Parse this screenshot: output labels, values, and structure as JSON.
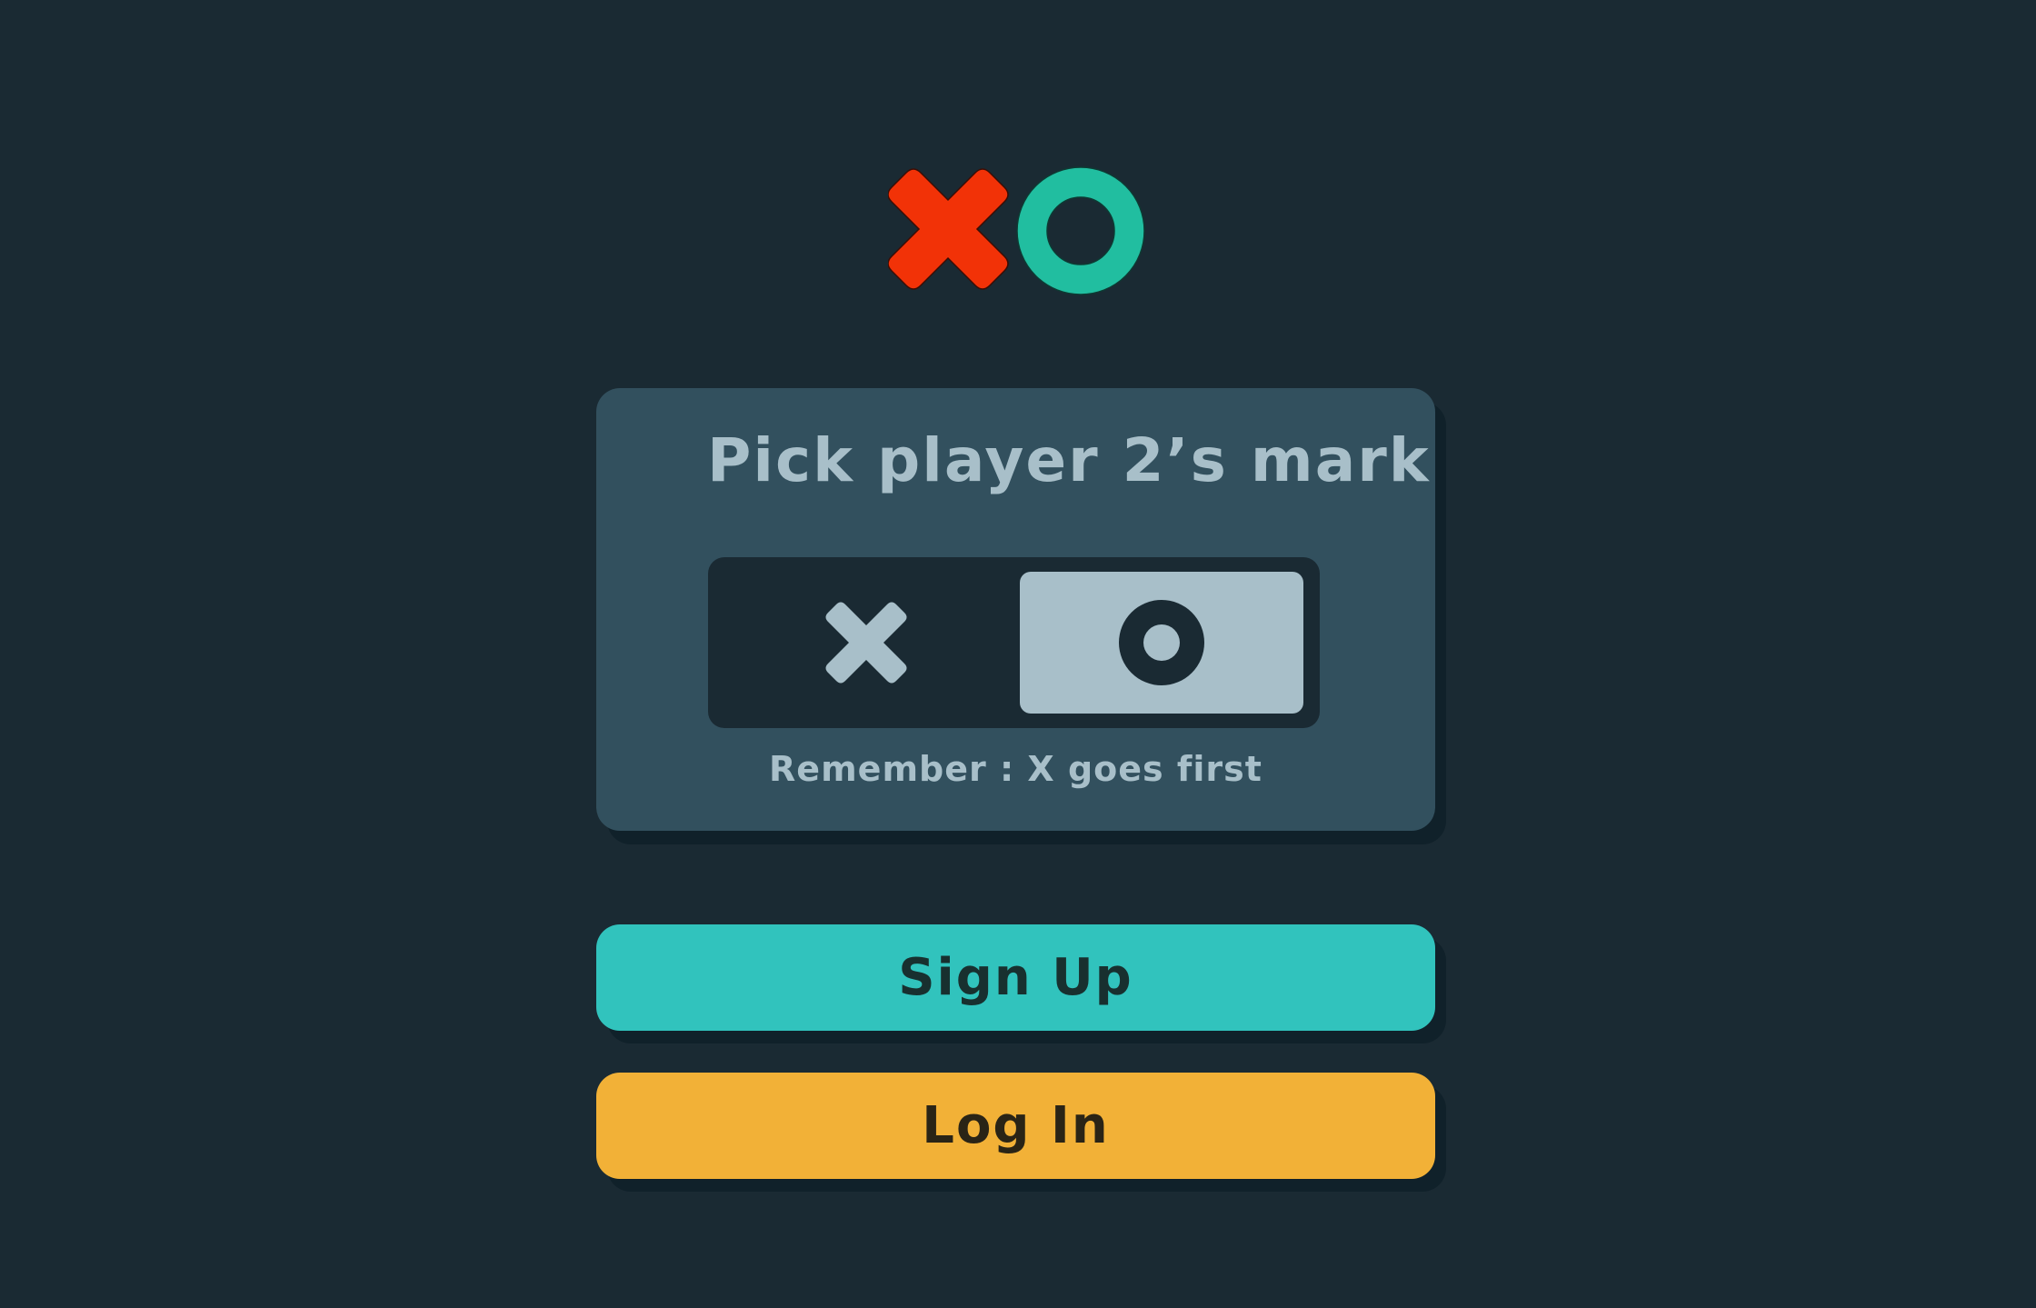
{
  "logo": {
    "icons": [
      "x-mark-icon",
      "o-mark-icon"
    ],
    "x_color": "#f23207",
    "o_color": "#21bea0"
  },
  "picker": {
    "title": "Pick player 2’s mark",
    "options": [
      {
        "mark": "X",
        "icon": "x-mark-icon",
        "selected": false
      },
      {
        "mark": "O",
        "icon": "o-mark-icon",
        "selected": true
      }
    ],
    "hint": "Remember : X goes first"
  },
  "buttons": {
    "signup_label": "Sign Up",
    "login_label": "Log In"
  },
  "colors": {
    "background": "#1a2a33",
    "card": "#32505e",
    "silver": "#a8bfc9",
    "teal": "#31c3bd",
    "yellow": "#f2b137"
  }
}
